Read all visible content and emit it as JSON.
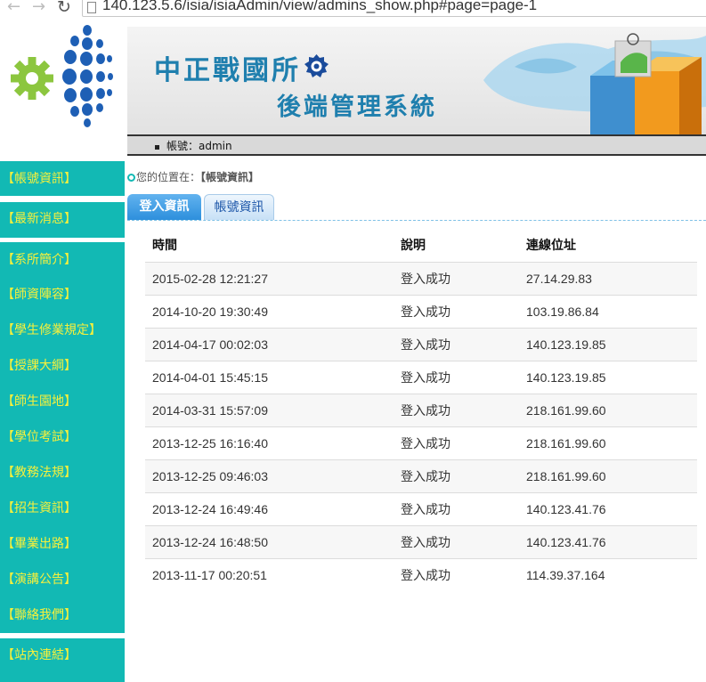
{
  "browser": {
    "url": "140.123.5.6/isia/isiaAdmin/view/admins_show.php#page=page-1"
  },
  "header": {
    "title_line1": "中正戰國所",
    "title_line2": "後端管理系統",
    "account_label": "帳號：admin"
  },
  "sidebar": {
    "items": [
      "【帳號資訊】",
      "【最新消息】",
      "【系所簡介】",
      "【師資陣容】",
      "【學生修業規定】",
      "【授課大綱】",
      "【師生園地】",
      "【學位考試】",
      "【教務法規】",
      "【招生資訊】",
      "【畢業出路】",
      "【演講公告】",
      "【聯絡我們】",
      "【站內連結】"
    ],
    "color": "#12b9b4",
    "text_color": "#f6f03c"
  },
  "breadcrumb": {
    "prefix": "您的位置在：",
    "current": "【帳號資訊】"
  },
  "tabs": {
    "active": "登入資訊",
    "inactive": "帳號資訊"
  },
  "table": {
    "headers": {
      "time": "時間",
      "desc": "說明",
      "ip": "連線位址"
    },
    "rows": [
      {
        "time": "2015-02-28 12:21:27",
        "desc": "登入成功",
        "ip": "27.14.29.83"
      },
      {
        "time": "2014-10-20 19:30:49",
        "desc": "登入成功",
        "ip": "103.19.86.84"
      },
      {
        "time": "2014-04-17 00:02:03",
        "desc": "登入成功",
        "ip": "140.123.19.85"
      },
      {
        "time": "2014-04-01 15:45:15",
        "desc": "登入成功",
        "ip": "140.123.19.85"
      },
      {
        "time": "2014-03-31 15:57:09",
        "desc": "登入成功",
        "ip": "218.161.99.60"
      },
      {
        "time": "2013-12-25 16:16:40",
        "desc": "登入成功",
        "ip": "218.161.99.60"
      },
      {
        "time": "2013-12-25 09:46:03",
        "desc": "登入成功",
        "ip": "218.161.99.60"
      },
      {
        "time": "2013-12-24 16:49:46",
        "desc": "登入成功",
        "ip": "140.123.41.76"
      },
      {
        "time": "2013-12-24 16:48:50",
        "desc": "登入成功",
        "ip": "140.123.41.76"
      },
      {
        "time": "2013-11-17 00:20:51",
        "desc": "登入成功",
        "ip": "114.39.37.164"
      }
    ]
  },
  "icons": {
    "back": "arrow-left-icon",
    "forward": "arrow-right-icon",
    "reload": "reload-icon",
    "page": "page-icon",
    "logo": "gear-dots-logo-icon",
    "emblem": "emblem-icon",
    "breadcrumb": "circle-icon"
  }
}
